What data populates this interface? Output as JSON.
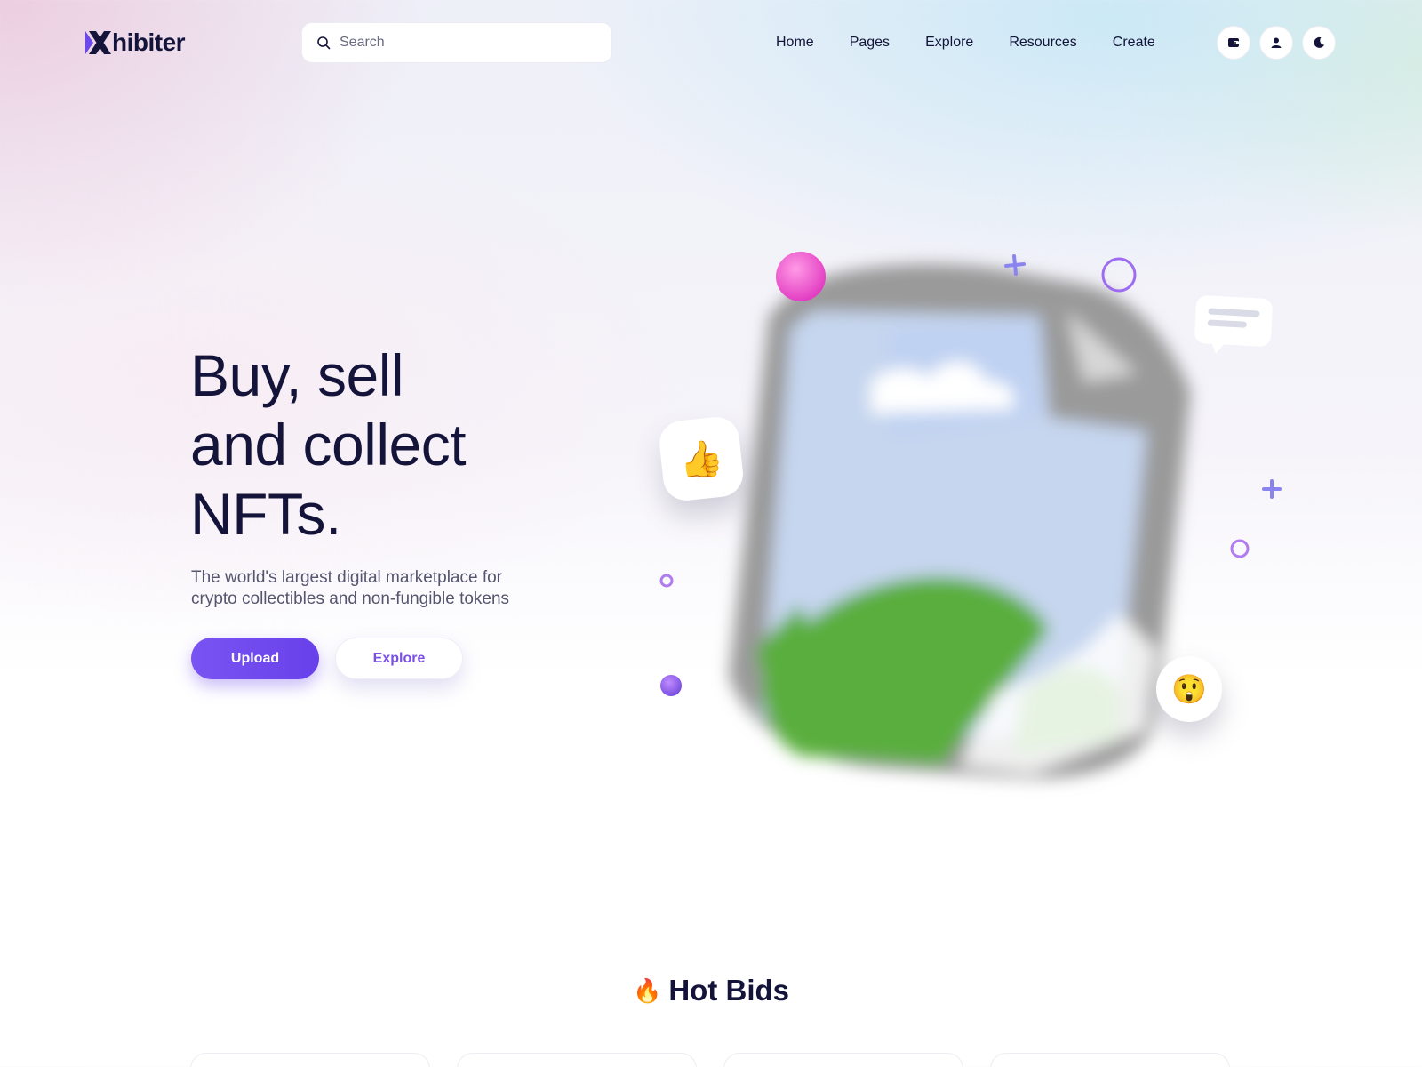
{
  "brand": {
    "name": "hibiter",
    "accent": "#6c47ea",
    "text": "#14143a"
  },
  "search": {
    "placeholder": "Search",
    "icon": "search-icon"
  },
  "nav": {
    "items": [
      {
        "label": "Home"
      },
      {
        "label": "Pages"
      },
      {
        "label": "Explore"
      },
      {
        "label": "Resources"
      },
      {
        "label": "Create"
      }
    ]
  },
  "header_actions": {
    "wallet_icon": "wallet-icon",
    "user_icon": "user-icon",
    "theme_icon": "moon-icon"
  },
  "hero": {
    "title_lines": [
      "Buy, sell",
      "and collect",
      "NFTs."
    ],
    "subtitle_lines": [
      "The world's largest digital marketplace for",
      "crypto collectibles and non-fungible tokens"
    ],
    "upload_label": "Upload",
    "explore_label": "Explore",
    "reactions": {
      "like": "👍",
      "wow": "😲"
    }
  },
  "hot_bids": {
    "icon": "🔥",
    "title": "Hot Bids",
    "card_count": 4
  }
}
